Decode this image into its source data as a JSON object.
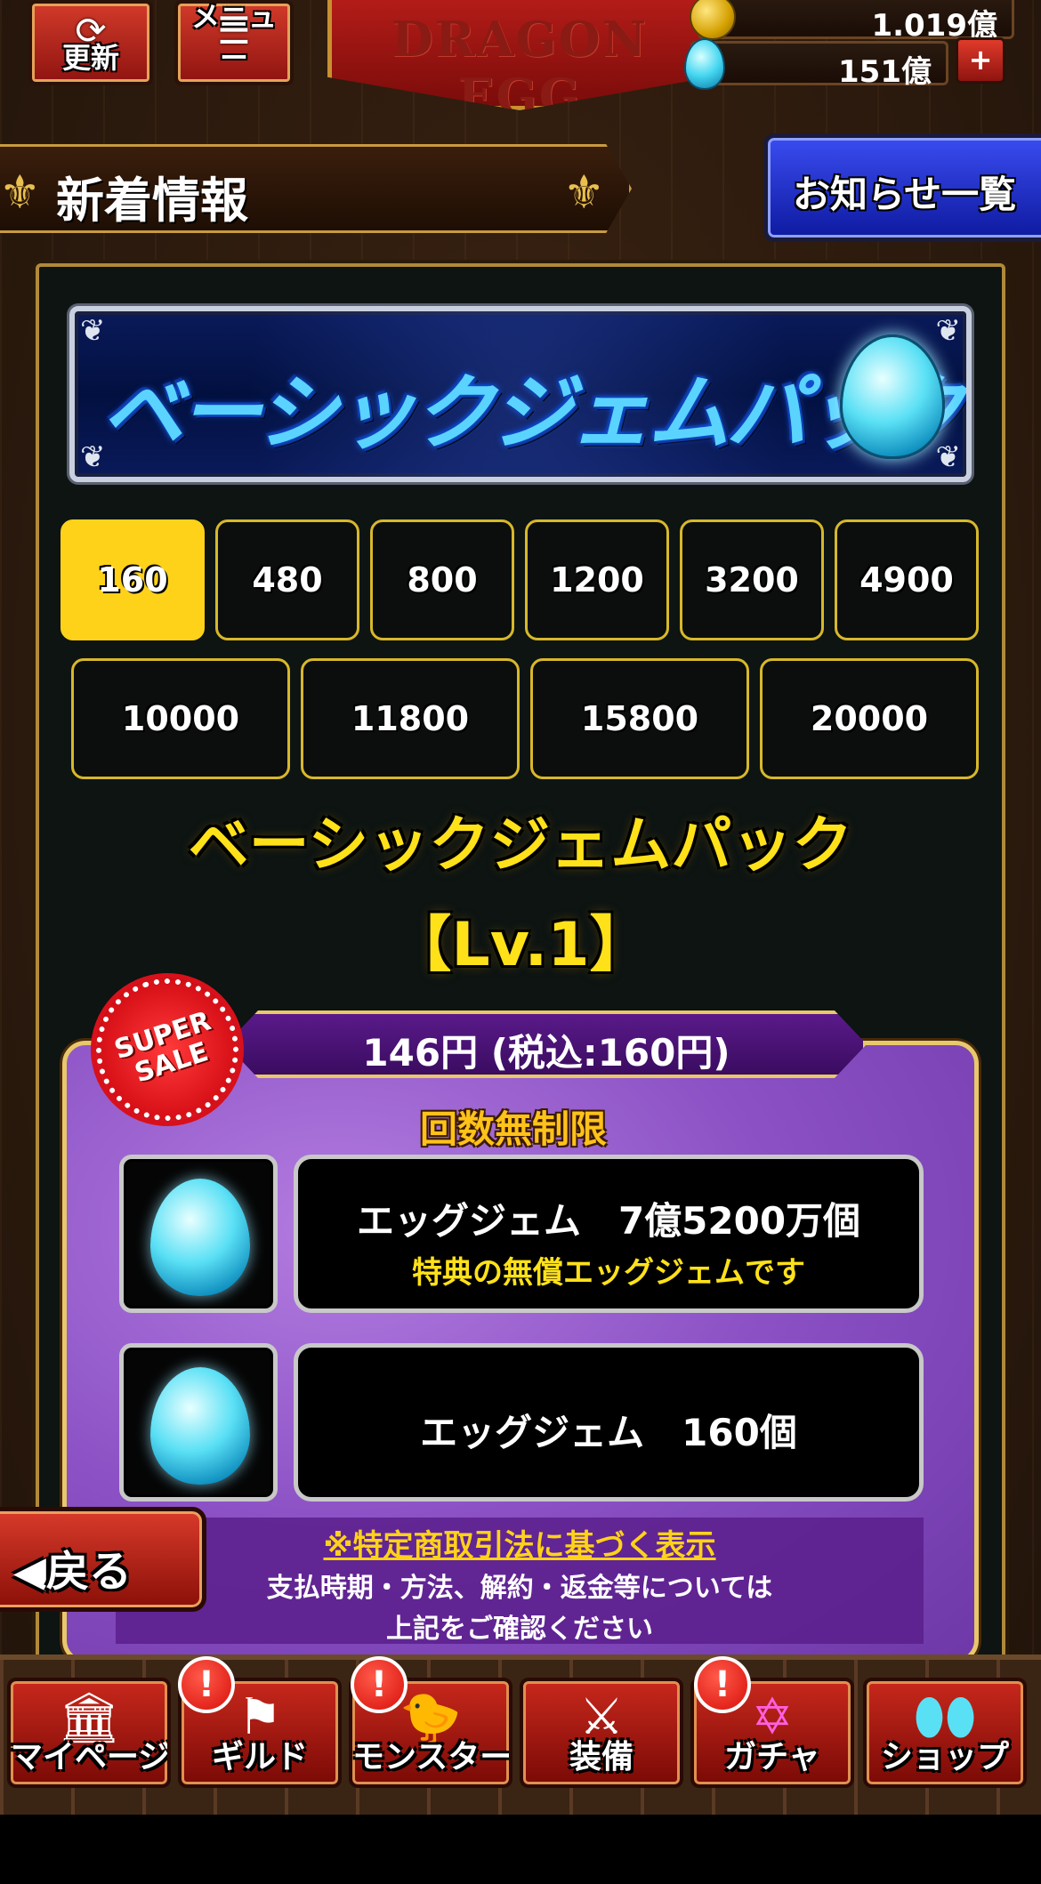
{
  "header": {
    "refresh_label": "更新",
    "menu_label": "メニュー",
    "logo_text": "DRAGON EGG",
    "gold_amount": "1.019億",
    "gem_amount": "151億",
    "plus_symbol": "+"
  },
  "section": {
    "title": "新着情報",
    "notice_list_label": "お知らせ一覧"
  },
  "banner": {
    "title": "ベーシックジェムパック"
  },
  "tiers": {
    "selected": "160",
    "row1": [
      "160",
      "480",
      "800",
      "1200",
      "3200",
      "4900"
    ],
    "row2": [
      "10000",
      "11800",
      "15800",
      "20000"
    ]
  },
  "pack": {
    "name": "ベーシックジェムパック",
    "level": "【Lv.1】",
    "sale_badge": "SUPER SALE",
    "price": "146円 (税込:160円)",
    "purchase_limit": "回数無制限",
    "items": [
      {
        "name": "エッグジェム　7億5200万個",
        "note": "特典の無償エッグジェムです"
      },
      {
        "name": "エッグジェム　160個",
        "note": ""
      }
    ]
  },
  "legal": {
    "heading": "※特定商取引法に基づく表示",
    "line1": "支払時期・方法、解約・返金等については",
    "line2": "上記をご確認ください"
  },
  "back_label": "戻る",
  "nav": {
    "items": [
      {
        "label": "マイページ",
        "icon": "house-icon",
        "alert": false
      },
      {
        "label": "ギルド",
        "icon": "guild-flag-icon",
        "alert": true
      },
      {
        "label": "モンスター",
        "icon": "monster-icon",
        "alert": true
      },
      {
        "label": "装備",
        "icon": "crossed-swords-icon",
        "alert": false
      },
      {
        "label": "ガチャ",
        "icon": "magic-circle-icon",
        "alert": true
      },
      {
        "label": "ショップ",
        "icon": "gem-icon",
        "alert": false
      }
    ],
    "alert_symbol": "!"
  },
  "colors": {
    "accent_yellow": "#ffd21a",
    "panel_purple": "#8a50c4",
    "button_red": "#c8281c",
    "notice_blue": "#2a3ce0"
  }
}
